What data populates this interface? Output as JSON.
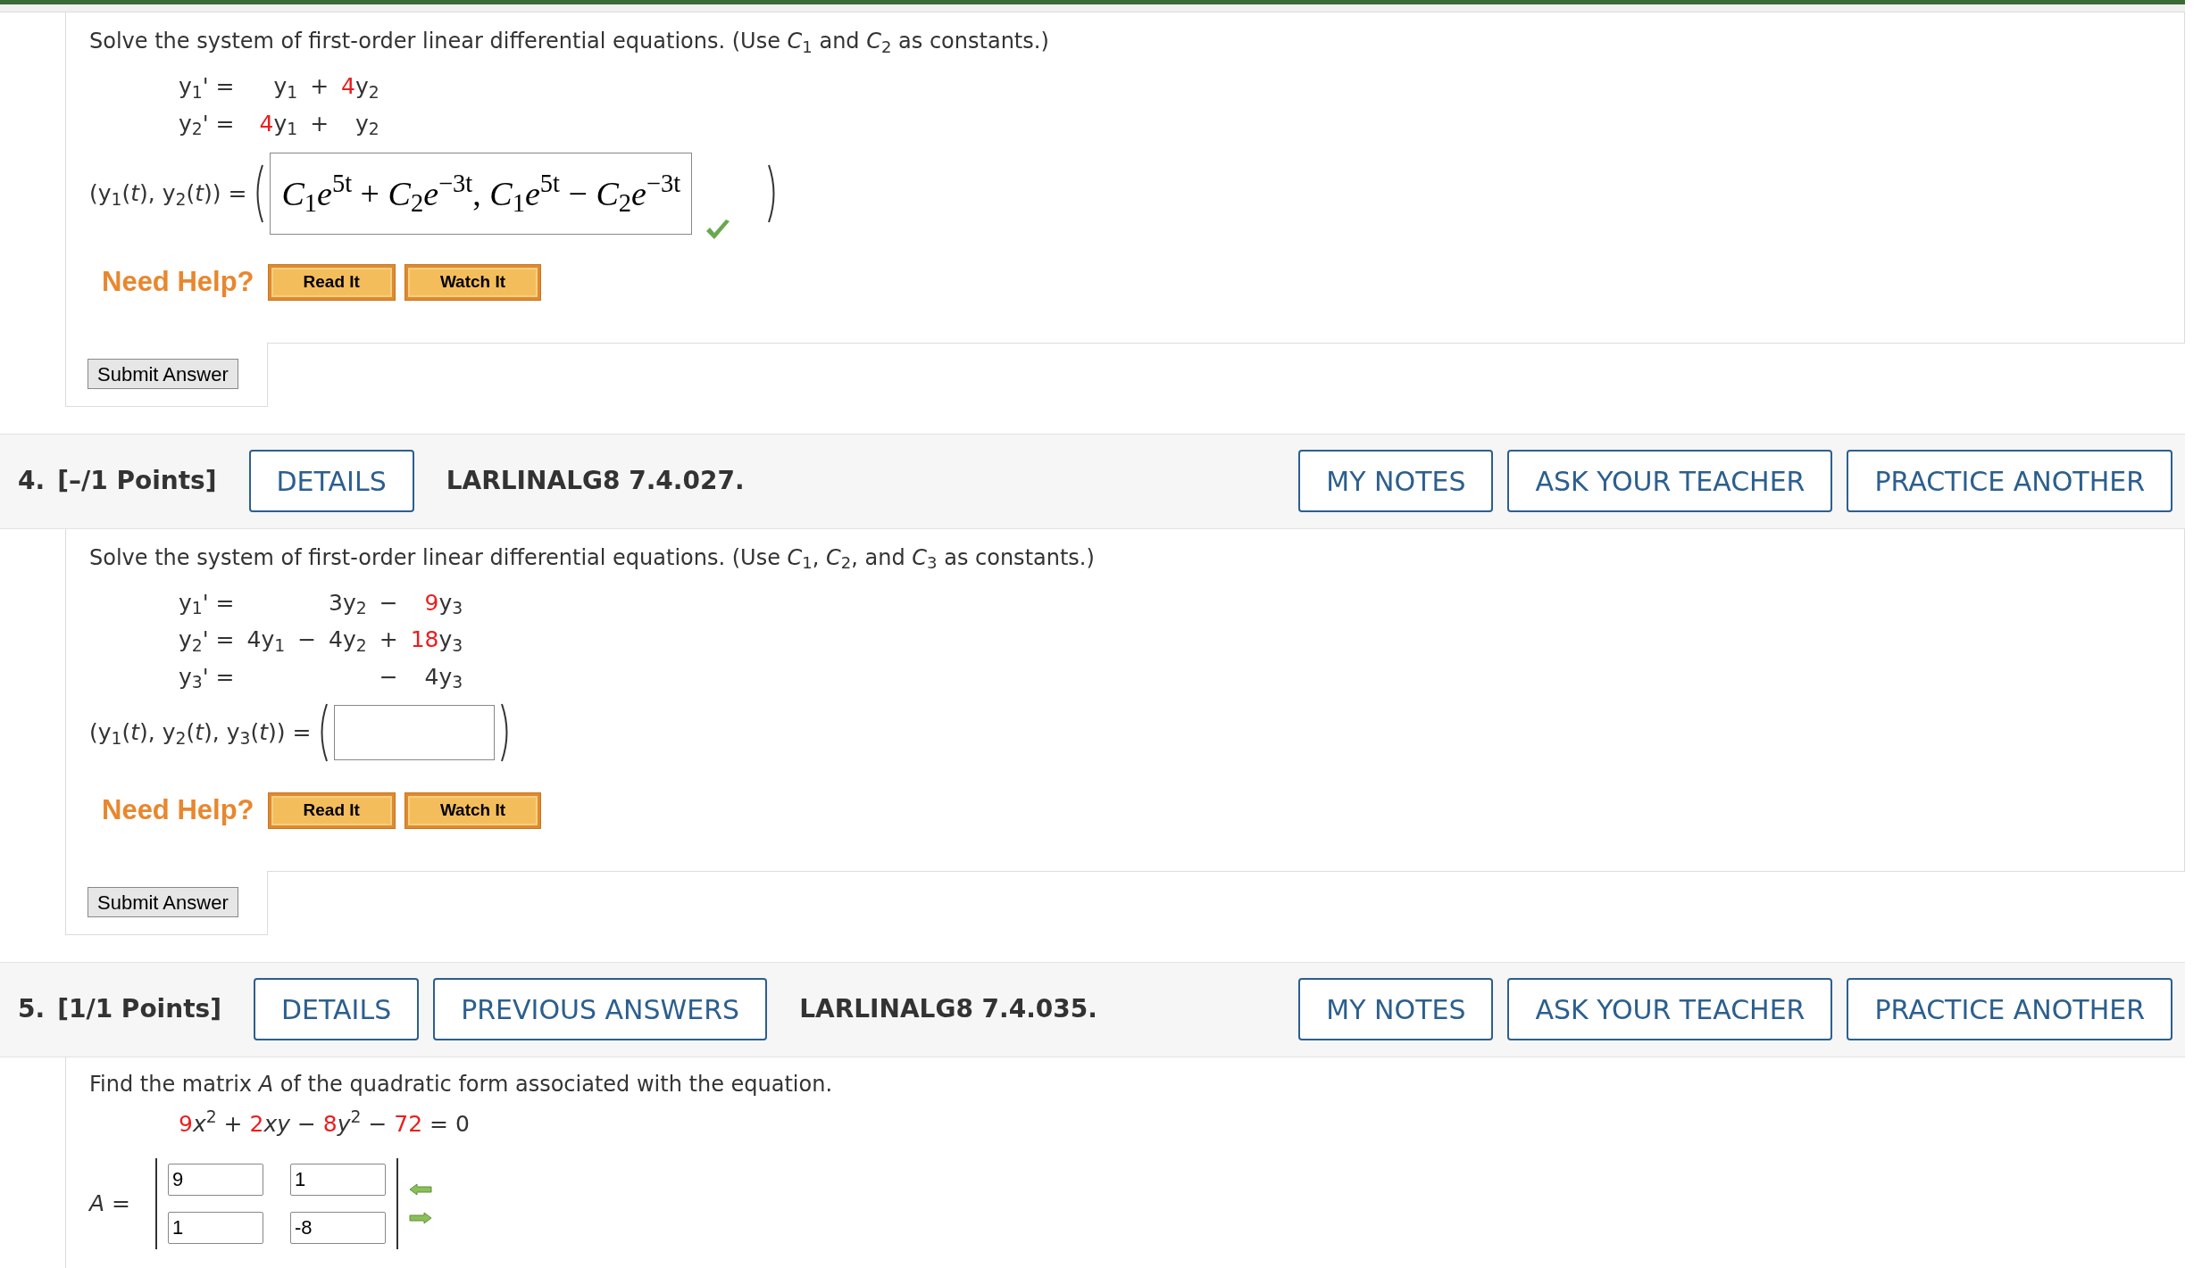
{
  "q3_tail": {
    "prompt": "Solve the system of first-order linear differential equations. (Use *C*$_{1}$ and *C*$_{2}$ as constants.)",
    "equations": [
      {
        "lhs": "y$_{1}$' =",
        "cells": [
          {
            "kind": "blank"
          },
          {
            "kind": "math",
            "parts": [
              {
                "text": "y$_{1}$",
                "highlighted": false
              }
            ]
          },
          {
            "kind": "math",
            "parts": [
              {
                "text": "+",
                "highlighted": false
              }
            ]
          },
          {
            "kind": "math",
            "parts": [
              {
                "text": "4",
                "highlighted": true
              },
              {
                "text": "y$_{2}$",
                "highlighted": false
              }
            ]
          }
        ]
      },
      {
        "lhs": "y$_{2}$' =",
        "cells": [
          {
            "kind": "blank"
          },
          {
            "kind": "math",
            "parts": [
              {
                "text": "4",
                "highlighted": true
              },
              {
                "text": "y$_{1}$",
                "highlighted": false
              }
            ]
          },
          {
            "kind": "math",
            "parts": [
              {
                "text": "+",
                "highlighted": false
              }
            ]
          },
          {
            "kind": "math",
            "parts": [
              {
                "text": " y$_{2}$",
                "highlighted": false
              }
            ]
          }
        ]
      }
    ],
    "answer_label": "(y$_{1}$(*t*), y$_{2}$(*t*)) =",
    "answer": "*C*$_{1}$*e*$^{5t}$ + *C*$_{2}$*e*$^{−3t}$, *C*$_{1}$*e*$^{5t}$ − *C*$_{2}$*e*$^{−3t}$",
    "correct": true,
    "help_label": "Need Help?",
    "help_buttons": [
      "Read It",
      "Watch It"
    ],
    "submit": "Submit Answer"
  },
  "q4": {
    "number": "4.",
    "points": "[–/1 Points]",
    "buttons": [
      "DETAILS"
    ],
    "code": "LARLINALG8 7.4.027.",
    "right_buttons": [
      "MY NOTES",
      "ASK YOUR TEACHER",
      "PRACTICE ANOTHER"
    ],
    "prompt": "Solve the system of first-order linear differential equations. (Use *C*$_{1}$, *C*$_{2}$, and *C*$_{3}$ as constants.)",
    "equations": [
      {
        "lhs": "y$_{1}$' =",
        "cells": [
          {
            "kind": "blank"
          },
          {
            "kind": "blank"
          },
          {
            "kind": "math",
            "parts": [
              {
                "text": "3y$_{2}$",
                "highlighted": false
              }
            ]
          },
          {
            "kind": "math",
            "parts": [
              {
                "text": "−",
                "highlighted": false
              }
            ]
          },
          {
            "kind": "math",
            "parts": [
              {
                "text": "9",
                "highlighted": true
              },
              {
                "text": "y$_{3}$",
                "highlighted": false
              }
            ]
          }
        ]
      },
      {
        "lhs": "y$_{2}$' =",
        "cells": [
          {
            "kind": "math",
            "parts": [
              {
                "text": "4y$_{1}$",
                "highlighted": false
              }
            ]
          },
          {
            "kind": "math",
            "parts": [
              {
                "text": "−",
                "highlighted": false
              }
            ]
          },
          {
            "kind": "math",
            "parts": [
              {
                "text": "4y$_{2}$",
                "highlighted": false
              }
            ]
          },
          {
            "kind": "math",
            "parts": [
              {
                "text": "+",
                "highlighted": false
              }
            ]
          },
          {
            "kind": "math",
            "parts": [
              {
                "text": "18",
                "highlighted": true
              },
              {
                "text": "y$_{3}$",
                "highlighted": false
              }
            ]
          }
        ]
      },
      {
        "lhs": "y$_{3}$' =",
        "cells": [
          {
            "kind": "blank"
          },
          {
            "kind": "blank"
          },
          {
            "kind": "blank"
          },
          {
            "kind": "math",
            "parts": [
              {
                "text": "−",
                "highlighted": false
              }
            ]
          },
          {
            "kind": "math",
            "parts": [
              {
                "text": "4y$_{3}$",
                "highlighted": false
              }
            ]
          }
        ]
      }
    ],
    "answer_label": "(y$_{1}$(*t*), y$_{2}$(*t*), y$_{3}$(*t*)) =",
    "help_label": "Need Help?",
    "help_buttons": [
      "Read It",
      "Watch It"
    ],
    "submit": "Submit Answer"
  },
  "q5": {
    "number": "5.",
    "points": "[1/1 Points]",
    "buttons": [
      "DETAILS",
      "PREVIOUS ANSWERS"
    ],
    "code": "LARLINALG8 7.4.035.",
    "right_buttons": [
      "MY NOTES",
      "ASK YOUR TEACHER",
      "PRACTICE ANOTHER"
    ],
    "prompt": "Find the matrix *A* of the quadratic form associated with the equation.",
    "equation": [
      {
        "text": "9",
        "highlighted": true
      },
      {
        "text": "*x*$^{2}$ + ",
        "highlighted": false
      },
      {
        "text": "2",
        "highlighted": true
      },
      {
        "text": "*xy* − ",
        "highlighted": false
      },
      {
        "text": "8",
        "highlighted": true
      },
      {
        "text": "*y*$^{2}$ − ",
        "highlighted": false
      },
      {
        "text": "72",
        "highlighted": true
      },
      {
        "text": " = 0",
        "highlighted": false
      }
    ],
    "matrix_label": "*A* =",
    "matrix": [
      [
        "9",
        "1"
      ],
      [
        "1",
        "-8"
      ]
    ]
  }
}
